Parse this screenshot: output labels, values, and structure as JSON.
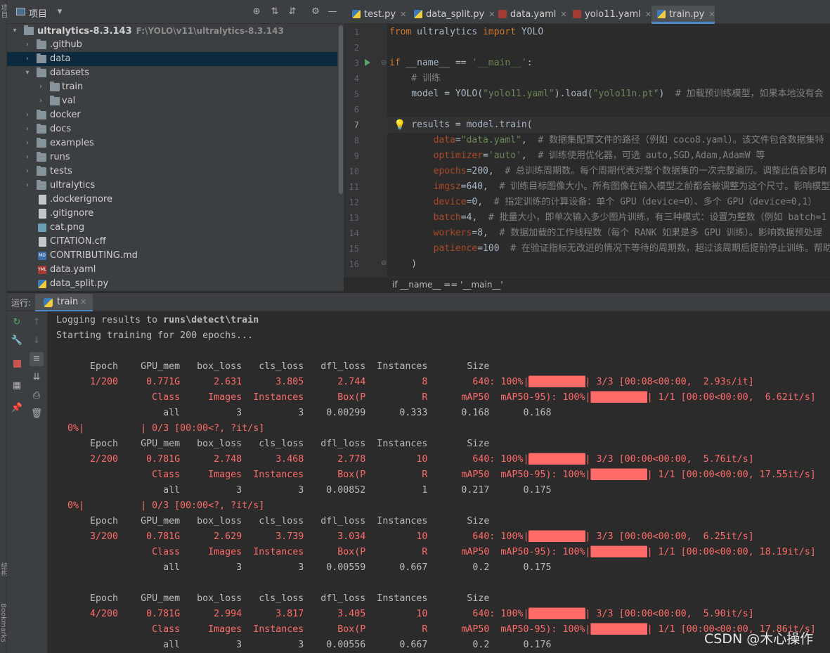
{
  "project_panel": {
    "title": "项目",
    "root_name": "ultralytics-8.3.143",
    "root_path": "F:\\YOLO\\v11\\ultralytics-8.3.143",
    "items": [
      {
        "label": ".github",
        "kind": "folder"
      },
      {
        "label": "data",
        "kind": "folder"
      },
      {
        "label": "datasets",
        "kind": "folder"
      },
      {
        "label": "train",
        "kind": "folder"
      },
      {
        "label": "val",
        "kind": "folder"
      },
      {
        "label": "docker",
        "kind": "folder"
      },
      {
        "label": "docs",
        "kind": "folder"
      },
      {
        "label": "examples",
        "kind": "folder"
      },
      {
        "label": "runs",
        "kind": "folder"
      },
      {
        "label": "tests",
        "kind": "folder"
      },
      {
        "label": "ultralytics",
        "kind": "folder"
      },
      {
        "label": ".dockerignore",
        "kind": "file"
      },
      {
        "label": ".gitignore",
        "kind": "file"
      },
      {
        "label": "cat.png",
        "kind": "png"
      },
      {
        "label": "CITATION.cff",
        "kind": "file"
      },
      {
        "label": "CONTRIBUTING.md",
        "kind": "md"
      },
      {
        "label": "data.yaml",
        "kind": "yml"
      },
      {
        "label": "data_split.py",
        "kind": "py"
      }
    ]
  },
  "left_stripe": {
    "top": "项目",
    "structure": "结构",
    "bookmarks": "Bookmarks"
  },
  "editor_tabs": [
    "test.py",
    "data_split.py",
    "data.yaml",
    "yolo11.yaml",
    "train.py"
  ],
  "code_lines": {
    "l1a": "from",
    "l1b": " ultralytics ",
    "l1c": "import",
    "l1d": " YOLO",
    "l3a": "if",
    "l3b": " __name__ ",
    "l3c": "== ",
    "l3d": "'__main__'",
    "l3e": ":",
    "l4": "    # 训练",
    "l5a": "    model = YOLO(",
    "l5b": "\"yolo11.yaml\"",
    "l5c": ").load(",
    "l5d": "\"yolo11n.pt\"",
    "l5e": ")  ",
    "l5f": "# 加载预训练模型，如果本地没有会",
    "l7a": "    results = model.train(",
    "l8a": "        data",
    "l8b": "=",
    "l8c": "\"data.yaml\"",
    "l8d": ",  ",
    "l8e": "# 数据集配置文件的路径（例如 coco8.yaml）。该文件包含数据集特",
    "l9a": "        optimizer",
    "l9b": "=",
    "l9c": "'auto'",
    "l9d": ",  ",
    "l9e": "# 训练使用优化器，可选 auto,SGD,Adam,AdamW 等",
    "l10a": "        epochs",
    "l10b": "=200,  ",
    "l10e": "# 总训练周期数。每个周期代表对整个数据集的一次完整遍历。调整此值会影响",
    "l11a": "        imgsz",
    "l11b": "=640,  ",
    "l11e": "# 训练目标图像大小。所有图像在输入模型之前都会被调整为这个尺寸。影响模型",
    "l12a": "        device",
    "l12b": "=0,  ",
    "l12e": "# 指定训练的计算设备：单个 GPU（device=0）、多个 GPU（device=0,1）",
    "l13a": "        batch",
    "l13b": "=4,  ",
    "l13e": "# 批量大小，即单次输入多少图片训练，有三种模式：设置为整数（例如 batch=1",
    "l14a": "        workers",
    "l14b": "=8,  ",
    "l14e": "# 数据加载的工作线程数（每个 RANK 如果是多 GPU 训练）。影响数据预处理",
    "l15a": "        patience",
    "l15b": "=100  ",
    "l15e": "# 在验证指标无改进的情况下等待的周期数，超过该周期后提前停止训练。帮助",
    "l16": "    )"
  },
  "breadcrumb": "if __name__ == '__main__'",
  "run_panel": {
    "label": "运行:",
    "tab": "train"
  },
  "console": {
    "l1_pre": "Logging results to ",
    "l1_bold": "runs\\detect\\train",
    "l2": "Starting training for 200 epochs...",
    "header": "      Epoch    GPU_mem   box_loss   cls_loss   dfl_loss  Instances       Size",
    "progress": "  0%|          | 0/3 [00:00<?, ?it/s]",
    "epochs": [
      {
        "train": "      1/200     0.771G      2.631      3.805      2.744          8        640: 100%|",
        "train_tail": "| 3/3 [00:08<00:00,  2.93s/it]",
        "val_head": "                 Class     Images  Instances      Box(P          R      mAP50  mAP50-95): 100%|",
        "val_tail": "| 1/1 [00:00<00:00,  6.62it/s]",
        "all": "                   all          3          3    0.00299      0.333      0.168      0.168"
      },
      {
        "train": "      2/200     0.781G      2.748      3.468      2.778         10        640: 100%|",
        "train_tail": "| 3/3 [00:00<00:00,  5.76it/s]",
        "val_head": "                 Class     Images  Instances      Box(P          R      mAP50  mAP50-95): 100%|",
        "val_tail": "| 1/1 [00:00<00:00, 17.55it/s]",
        "all": "                   all          3          3    0.00852          1      0.217      0.175"
      },
      {
        "train": "      3/200     0.781G      2.629      3.739      3.034         10        640: 100%|",
        "train_tail": "| 3/3 [00:00<00:00,  6.25it/s]",
        "val_head": "                 Class     Images  Instances      Box(P          R      mAP50  mAP50-95): 100%|",
        "val_tail": "| 1/1 [00:00<00:00, 18.19it/s]",
        "all": "                   all          3          3    0.00559      0.667        0.2      0.175"
      },
      {
        "train": "      4/200     0.781G      2.994      3.817      3.405         10        640: 100%|",
        "train_tail": "| 3/3 [00:00<00:00,  5.90it/s]",
        "val_head": "                 Class     Images  Instances      Box(P          R      mAP50  mAP50-95): 100%|",
        "val_tail": "| 1/1 [00:00<00:00, 17.86it/s]",
        "all": "                   all          3          3    0.00556      0.667        0.2      0.176"
      }
    ]
  },
  "watermark": "CSDN @木心操作"
}
